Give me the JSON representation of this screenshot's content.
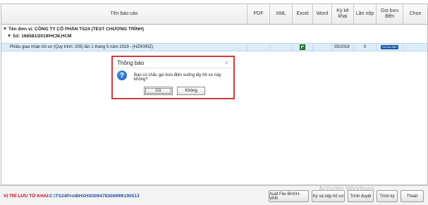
{
  "columns": {
    "report_name": "Tên báo cáo",
    "pdf": "PDF",
    "xml": "XML",
    "excel": "Excel",
    "word": "Word",
    "period": "Kỳ kê khai",
    "submissions": "Lần nộp",
    "call_post": "Gọi bưu điện",
    "select": "Chọn"
  },
  "grid": {
    "unit_group": "Tên đơn vị: CÔNG TY CỔ PHẦN TS24 (TEST CHƯƠNG TRÌNH)",
    "doc_group": "Số: 166581/2019/HCM,HCM",
    "row": {
      "name": "Phiếu giao nhận hồ sơ (Quy trình: 205) lần 1 tháng 5 năm 2019 - (HZ0000Z)",
      "period": "05/2019",
      "submissions": "0",
      "call_badge": "Gọi bưu điện"
    }
  },
  "dialog": {
    "title": "Thông báo",
    "close": "×",
    "message": "Bạn có chắc gọi bưu điện xuống lấy hồ sơ này không?",
    "yes": "Có",
    "no": "Không"
  },
  "footer": {
    "path_label": "VỊ TRÍ LƯU TỜ KHAI:",
    "path_value": "C:\\TS24Pro\\BHXH\\0309478306999\\190513",
    "buttons": [
      "Xuất File BHXH-VAN",
      "Ký và nộp hồ sơ",
      "Trình duyệt",
      "Trình ký",
      "Thoát"
    ]
  },
  "watermark": "Activate Windows"
}
